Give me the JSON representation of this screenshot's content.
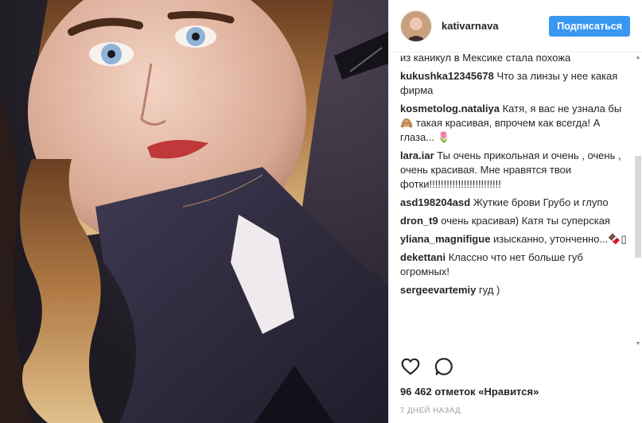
{
  "post": {
    "username": "kativarnava",
    "follow_label": "Подписаться",
    "likes_text": "96 462 отметок «Нравится»",
    "time_text": "7 ДНЕЙ НАЗАД"
  },
  "partial_comment": "из каникул в Мексике стала похожа",
  "comments": [
    {
      "user": "kukushka12345678",
      "text": "Что за линзы у нее какая фирма"
    },
    {
      "user": "kosmetolog.nataliya",
      "text": "Катя, я вас не узнала бы🙈 такая красивая, впрочем как всегда! А глаза... 🌷"
    },
    {
      "user": "lara.iar",
      "text": "Ты очень прикольная и очень , очень , очень красивая. Мне нравятся твои фотки!!!!!!!!!!!!!!!!!!!!!!!!!"
    },
    {
      "user": "asd198204asd",
      "text": "Жуткие брови Грубо и глупо"
    },
    {
      "user": "dron_t9",
      "text": "очень красивая) Катя ты суперская"
    },
    {
      "user": "yliana_magnifigue",
      "text": "изысканно, утонченно...🍫▯"
    },
    {
      "user": "dekettani",
      "text": "Классно что нет больше губ огромных!"
    },
    {
      "user": "sergeevartemiy",
      "text": "гуд )"
    }
  ],
  "icons": {
    "like": "heart-outline-icon",
    "comment": "speech-bubble-icon"
  },
  "colors": {
    "follow_button": "#3897f0",
    "time_text": "#999999"
  }
}
